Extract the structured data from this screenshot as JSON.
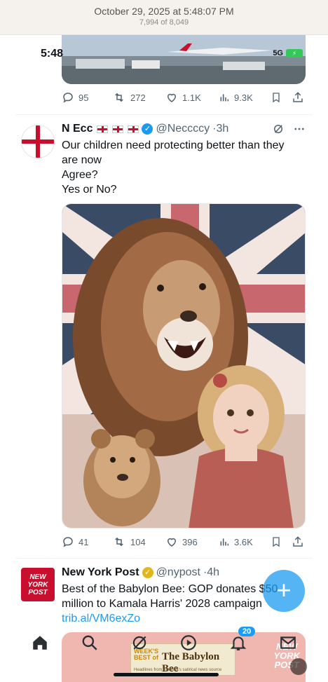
{
  "capture": {
    "date": "October 29, 2025 at 5:48:07 PM",
    "count": "7,994 of 8,049"
  },
  "status_bar": {
    "time": "5:48",
    "network": "5G",
    "battery": "⚡"
  },
  "colors": {
    "accent": "#1d9bf0",
    "england_red": "#c8102e",
    "verified_blue": "#1d9bf0",
    "verified_gold": "#e2b719"
  },
  "prev_tweet": {
    "actions": {
      "replies": "95",
      "retweets": "272",
      "likes": "1.1K",
      "views": "9.3K"
    }
  },
  "tweet1": {
    "name": "N Ecc",
    "handle": "@Neccccy",
    "time": "·3h",
    "text": [
      "Our children need protecting better than they",
      "are now",
      "Agree?",
      "Yes or No?"
    ],
    "actions": {
      "replies": "41",
      "retweets": "104",
      "likes": "396",
      "views": "3.6K"
    }
  },
  "tweet2": {
    "avatar": [
      "NEW",
      "YORK",
      "POST"
    ],
    "name": "New York Post",
    "handle": "@nypost",
    "time": "·4h",
    "text": [
      "Best of the Babylon Bee: GOP donates $50",
      "million to Kamala Harris' 2028 campaign"
    ],
    "link": "trib.al/VM6exZo",
    "card": {
      "week": [
        "WEEK'S",
        "BEST of"
      ],
      "title": "The Babylon Bee",
      "subtitle": "Headlines from America's satirical news source"
    },
    "watermark": [
      "NEW",
      "YORK",
      "POST"
    ]
  },
  "fab": {
    "label": "+"
  },
  "nav": {
    "notifications_badge": "20"
  }
}
